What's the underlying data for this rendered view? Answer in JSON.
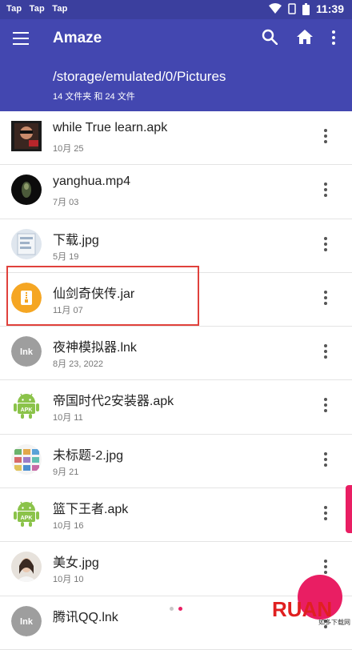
{
  "status_bar": {
    "apps": [
      "Tap",
      "Tap",
      "Tap"
    ],
    "time": "11:39"
  },
  "app_bar": {
    "title": "Amaze",
    "path": "/storage/emulated/0/Pictures",
    "counts": "14 文件夹 和 24 文件",
    "icons": [
      "menu-icon",
      "search-icon",
      "home-icon",
      "more-vert-icon"
    ]
  },
  "files": [
    {
      "name": "while True learn.apk",
      "date": "10月 25",
      "thumb": "image"
    },
    {
      "name": "yanghua.mp4",
      "date": "7月 03",
      "thumb": "video"
    },
    {
      "name": "下载.jpg",
      "date": "5月 19",
      "thumb": "image"
    },
    {
      "name": "仙剑奇侠传.jar",
      "date": "11月 07",
      "thumb": "archive"
    },
    {
      "name": "夜神模拟器.lnk",
      "date": "8月 23, 2022",
      "thumb": "lnk",
      "thumb_label": "lnk"
    },
    {
      "name": "帝国时代2安装器.apk",
      "date": "10月 11",
      "thumb": "apk",
      "thumb_label": "APK"
    },
    {
      "name": "未标题-2.jpg",
      "date": "9月 21",
      "thumb": "image"
    },
    {
      "name": "篮下王者.apk",
      "date": "10月 16",
      "thumb": "apk",
      "thumb_label": "APK"
    },
    {
      "name": "美女.jpg",
      "date": "10月 10",
      "thumb": "image"
    },
    {
      "name": "腾讯QQ.lnk",
      "date": "",
      "thumb": "lnk",
      "thumb_label": "lnk"
    }
  ],
  "watermark": {
    "text": "RUAN",
    "sub": "如多下载网"
  },
  "colors": {
    "status_bar": "#3b3f9e",
    "app_bar": "#4347b0",
    "accent": "#e91e63",
    "highlight_box": "#e0413c",
    "archive_icon": "#f5a623",
    "apk_icon": "#8bc34a",
    "lnk_icon": "#9e9e9e"
  }
}
